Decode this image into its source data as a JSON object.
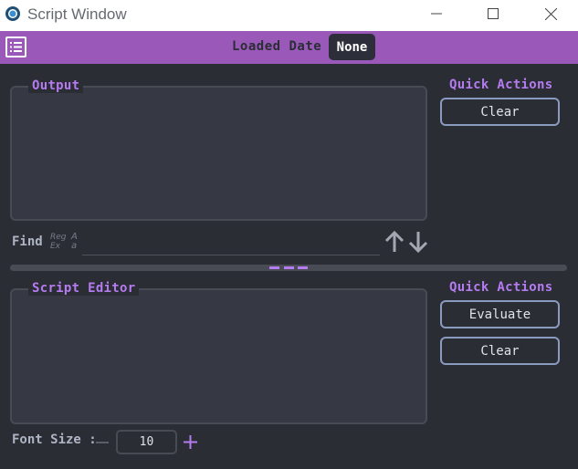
{
  "window": {
    "title": "Script Window",
    "icon": "app-logo-icon",
    "controls": [
      "minimize-icon",
      "maximize-icon",
      "close-icon"
    ]
  },
  "header": {
    "menu_icon": "menu-list-icon",
    "loaded_date_label": "Loaded Date",
    "loaded_date_value": "None",
    "accent": "#9a59b8"
  },
  "output": {
    "legend": "Output",
    "quick_actions_title": "Quick Actions",
    "clear_label": "Clear"
  },
  "find": {
    "label": "Find",
    "regex_toggle": "Reg Ex",
    "case_toggle": "A a",
    "value": "",
    "prev_icon": "arrow-up-icon",
    "next_icon": "arrow-down-icon"
  },
  "editor": {
    "legend": "Script Editor",
    "quick_actions_title": "Quick Actions",
    "evaluate_label": "Evaluate",
    "clear_label": "Clear"
  },
  "font_size": {
    "label": "Font Size :",
    "value": "10"
  },
  "colors": {
    "background": "#2b2d34",
    "panel": "#363843",
    "accent_text": "#b57bf0",
    "button_border": "#8a9bbf"
  }
}
